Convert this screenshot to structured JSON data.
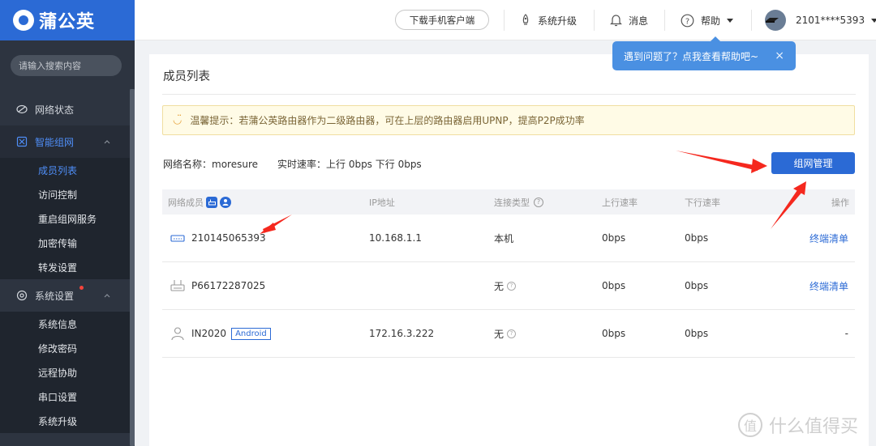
{
  "brand": {
    "name": "蒲公英"
  },
  "search": {
    "placeholder": "请输入搜索内容"
  },
  "sidebar": {
    "items": [
      {
        "label": "网络状态",
        "icon": "network-status-icon"
      },
      {
        "label": "智能组网",
        "icon": "smart-network-icon"
      },
      {
        "label": "系统设置",
        "icon": "settings-icon"
      }
    ],
    "network_sub": [
      "成员列表",
      "访问控制",
      "重启组网服务",
      "加密传输",
      "转发设置"
    ],
    "settings_sub": [
      "系统信息",
      "修改密码",
      "远程协助",
      "串口设置",
      "系统升级"
    ]
  },
  "header": {
    "download_label": "下载手机客户端",
    "upgrade_label": "系统升级",
    "messages_label": "消息",
    "help_label": "帮助",
    "account": "2101****5393"
  },
  "tooltip": {
    "text": "遇到问题了？点我查看帮助吧~",
    "close": "×"
  },
  "card": {
    "title": "成员列表",
    "notice": "温馨提示：若蒲公英路由器作为二级路由器，可在上层的路由器启用UPNP，提高P2P成功率",
    "network_name": "网络名称：moresure",
    "speed": "实时速率：上行 0bps 下行 0bps",
    "manage_button": "组网管理"
  },
  "table": {
    "headers": {
      "member": "网络成员",
      "ip": "IP地址",
      "conn": "连接类型",
      "up": "上行速率",
      "down": "下行速率",
      "action": "操作"
    },
    "rows": [
      {
        "name": "210145065393",
        "ip": "10.168.1.1",
        "conn": "本机",
        "up": "0bps",
        "down": "0bps",
        "action": "终端清单",
        "icon": "router-icon"
      },
      {
        "name": "P66172287025",
        "ip": "",
        "conn": "无",
        "up": "0bps",
        "down": "0bps",
        "action": "终端清单",
        "icon": "printer-device-icon"
      },
      {
        "name": "IN2020",
        "tag": "Android",
        "ip": "172.16.3.222",
        "conn": "无",
        "up": "0bps",
        "down": "0bps",
        "action": "-",
        "icon": "user-icon"
      }
    ]
  },
  "watermark": {
    "text": "什么值得买",
    "glyph": "值"
  },
  "colors": {
    "primary": "#2b6ad5",
    "sidebar": "#2d3440",
    "notice_bg": "#fffbe6",
    "arrow": "#f5281e"
  }
}
